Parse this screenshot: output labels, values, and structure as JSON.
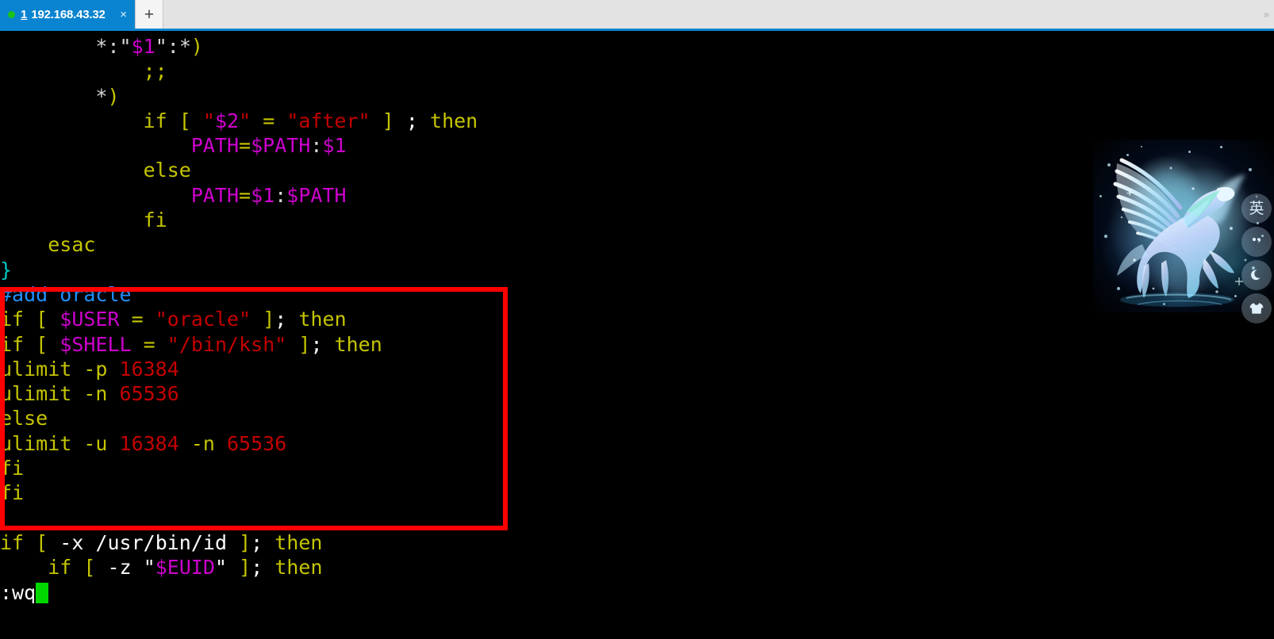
{
  "window": {
    "tab": {
      "index": "1",
      "title": "192.168.43.32",
      "close_label": "×",
      "status_dot_color": "#19c419",
      "active_color": "#0a84d0"
    },
    "new_tab_label": "+",
    "overflow_label": "»"
  },
  "terminal": {
    "annotation_box_color": "#ff0000",
    "cursor_color": "#00d800",
    "command_line": ":wq",
    "lines": [
      {
        "id": "line-case-star-1",
        "tokens": [
          {
            "t": "        ",
            "c": "c-white"
          },
          {
            "t": "*",
            "c": "c-white"
          },
          {
            "t": ":",
            "c": "c-white"
          },
          {
            "t": "\"",
            "c": "c-white"
          },
          {
            "t": "$1",
            "c": "c-magenta"
          },
          {
            "t": "\"",
            "c": "c-white"
          },
          {
            "t": ":",
            "c": "c-white"
          },
          {
            "t": "*",
            "c": "c-white"
          },
          {
            "t": ")",
            "c": "c-yellow"
          }
        ]
      },
      {
        "id": "line-double-semicolon",
        "tokens": [
          {
            "t": "            ",
            "c": "c-white"
          },
          {
            "t": ";;",
            "c": "c-yellow"
          }
        ]
      },
      {
        "id": "line-case-star-2",
        "tokens": [
          {
            "t": "        ",
            "c": "c-white"
          },
          {
            "t": "*",
            "c": "c-white"
          },
          {
            "t": ")",
            "c": "c-yellow"
          }
        ]
      },
      {
        "id": "line-if-after",
        "tokens": [
          {
            "t": "            ",
            "c": "c-white"
          },
          {
            "t": "if",
            "c": "c-yellow"
          },
          {
            "t": " ",
            "c": "c-white"
          },
          {
            "t": "[",
            "c": "c-yellow"
          },
          {
            "t": " ",
            "c": "c-white"
          },
          {
            "t": "\"",
            "c": "c-red"
          },
          {
            "t": "$2",
            "c": "c-magenta"
          },
          {
            "t": "\"",
            "c": "c-red"
          },
          {
            "t": " ",
            "c": "c-white"
          },
          {
            "t": "=",
            "c": "c-yellow"
          },
          {
            "t": " ",
            "c": "c-white"
          },
          {
            "t": "\"after\"",
            "c": "c-red"
          },
          {
            "t": " ",
            "c": "c-white"
          },
          {
            "t": "]",
            "c": "c-yellow"
          },
          {
            "t": " ",
            "c": "c-white"
          },
          {
            "t": ";",
            "c": "c-brwhite"
          },
          {
            "t": " ",
            "c": "c-white"
          },
          {
            "t": "then",
            "c": "c-yellow"
          }
        ]
      },
      {
        "id": "line-path-after",
        "tokens": [
          {
            "t": "                ",
            "c": "c-white"
          },
          {
            "t": "PATH",
            "c": "c-magenta"
          },
          {
            "t": "=",
            "c": "c-yellow"
          },
          {
            "t": "$PATH",
            "c": "c-magenta"
          },
          {
            "t": ":",
            "c": "c-white"
          },
          {
            "t": "$1",
            "c": "c-magenta"
          }
        ]
      },
      {
        "id": "line-else-1",
        "tokens": [
          {
            "t": "            ",
            "c": "c-white"
          },
          {
            "t": "else",
            "c": "c-yellow"
          }
        ]
      },
      {
        "id": "line-path-before",
        "tokens": [
          {
            "t": "                ",
            "c": "c-white"
          },
          {
            "t": "PATH",
            "c": "c-magenta"
          },
          {
            "t": "=",
            "c": "c-yellow"
          },
          {
            "t": "$1",
            "c": "c-magenta"
          },
          {
            "t": ":",
            "c": "c-white"
          },
          {
            "t": "$PATH",
            "c": "c-magenta"
          }
        ]
      },
      {
        "id": "line-fi-1",
        "tokens": [
          {
            "t": "            ",
            "c": "c-white"
          },
          {
            "t": "fi",
            "c": "c-yellow"
          }
        ]
      },
      {
        "id": "line-esac",
        "tokens": [
          {
            "t": "    ",
            "c": "c-white"
          },
          {
            "t": "esac",
            "c": "c-yellow"
          }
        ]
      },
      {
        "id": "line-close-brace",
        "tokens": [
          {
            "t": "}",
            "c": "c-cyan"
          }
        ]
      },
      {
        "id": "line-comment-add-oracle",
        "tokens": [
          {
            "t": "#add oracle",
            "c": "c-blue"
          }
        ]
      },
      {
        "id": "line-if-user-oracle",
        "tokens": [
          {
            "t": "if",
            "c": "c-yellow"
          },
          {
            "t": " ",
            "c": "c-white"
          },
          {
            "t": "[",
            "c": "c-yellow"
          },
          {
            "t": " ",
            "c": "c-white"
          },
          {
            "t": "$USER",
            "c": "c-magenta"
          },
          {
            "t": " ",
            "c": "c-white"
          },
          {
            "t": "=",
            "c": "c-yellow"
          },
          {
            "t": " ",
            "c": "c-white"
          },
          {
            "t": "\"oracle\"",
            "c": "c-red"
          },
          {
            "t": " ",
            "c": "c-white"
          },
          {
            "t": "]",
            "c": "c-yellow"
          },
          {
            "t": ";",
            "c": "c-brwhite"
          },
          {
            "t": " ",
            "c": "c-white"
          },
          {
            "t": "then",
            "c": "c-yellow"
          }
        ]
      },
      {
        "id": "line-if-shell-ksh",
        "tokens": [
          {
            "t": "if",
            "c": "c-yellow"
          },
          {
            "t": " ",
            "c": "c-white"
          },
          {
            "t": "[",
            "c": "c-yellow"
          },
          {
            "t": " ",
            "c": "c-white"
          },
          {
            "t": "$SHELL",
            "c": "c-magenta"
          },
          {
            "t": " ",
            "c": "c-white"
          },
          {
            "t": "=",
            "c": "c-yellow"
          },
          {
            "t": " ",
            "c": "c-white"
          },
          {
            "t": "\"/bin/ksh\"",
            "c": "c-red"
          },
          {
            "t": " ",
            "c": "c-white"
          },
          {
            "t": "]",
            "c": "c-yellow"
          },
          {
            "t": ";",
            "c": "c-brwhite"
          },
          {
            "t": " ",
            "c": "c-white"
          },
          {
            "t": "then",
            "c": "c-yellow"
          }
        ]
      },
      {
        "id": "line-ulimit-p",
        "tokens": [
          {
            "t": "ulimit -p ",
            "c": "c-yellow"
          },
          {
            "t": "16384",
            "c": "c-red"
          }
        ]
      },
      {
        "id": "line-ulimit-n",
        "tokens": [
          {
            "t": "ulimit -n ",
            "c": "c-yellow"
          },
          {
            "t": "65536",
            "c": "c-red"
          }
        ]
      },
      {
        "id": "line-else-2",
        "tokens": [
          {
            "t": "else",
            "c": "c-yellow"
          }
        ]
      },
      {
        "id": "line-ulimit-u-n",
        "tokens": [
          {
            "t": "ulimit -u ",
            "c": "c-yellow"
          },
          {
            "t": "16384",
            "c": "c-red"
          },
          {
            "t": " -n ",
            "c": "c-yellow"
          },
          {
            "t": "65536",
            "c": "c-red"
          }
        ]
      },
      {
        "id": "line-fi-2",
        "tokens": [
          {
            "t": "fi",
            "c": "c-yellow"
          }
        ]
      },
      {
        "id": "line-fi-3",
        "tokens": [
          {
            "t": "fi",
            "c": "c-yellow"
          }
        ]
      },
      {
        "id": "line-blank-1",
        "tokens": [
          {
            "t": " ",
            "c": "c-white"
          }
        ]
      },
      {
        "id": "line-if-x-usr-bin-id",
        "tokens": [
          {
            "t": "if",
            "c": "c-yellow"
          },
          {
            "t": " ",
            "c": "c-white"
          },
          {
            "t": "[",
            "c": "c-yellow"
          },
          {
            "t": " ",
            "c": "c-white"
          },
          {
            "t": "-x /usr/bin/id",
            "c": "c-brwhite"
          },
          {
            "t": " ",
            "c": "c-white"
          },
          {
            "t": "]",
            "c": "c-yellow"
          },
          {
            "t": ";",
            "c": "c-brwhite"
          },
          {
            "t": " ",
            "c": "c-white"
          },
          {
            "t": "then",
            "c": "c-yellow"
          }
        ]
      },
      {
        "id": "line-if-z-euid",
        "tokens": [
          {
            "t": "    ",
            "c": "c-white"
          },
          {
            "t": "if",
            "c": "c-yellow"
          },
          {
            "t": " ",
            "c": "c-white"
          },
          {
            "t": "[",
            "c": "c-yellow"
          },
          {
            "t": " ",
            "c": "c-white"
          },
          {
            "t": "-z",
            "c": "c-brwhite"
          },
          {
            "t": " ",
            "c": "c-white"
          },
          {
            "t": "\"",
            "c": "c-brwhite"
          },
          {
            "t": "$EUID",
            "c": "c-magenta"
          },
          {
            "t": "\"",
            "c": "c-brwhite"
          },
          {
            "t": " ",
            "c": "c-white"
          },
          {
            "t": "]",
            "c": "c-yellow"
          },
          {
            "t": ";",
            "c": "c-brwhite"
          },
          {
            "t": " ",
            "c": "c-white"
          },
          {
            "t": "then",
            "c": "c-yellow"
          }
        ]
      }
    ]
  },
  "ime": {
    "name": "sogou-ime-floating-bar",
    "buttons": [
      {
        "id": "ime-language-mode",
        "icon": "english-mode-icon",
        "label": "英"
      },
      {
        "id": "ime-punctuation-mode",
        "icon": "punctuation-icon",
        "label": ""
      },
      {
        "id": "ime-night-mode",
        "icon": "crescent-moon-icon",
        "label": ""
      },
      {
        "id": "ime-skin",
        "icon": "tshirt-skin-icon",
        "label": ""
      }
    ]
  }
}
